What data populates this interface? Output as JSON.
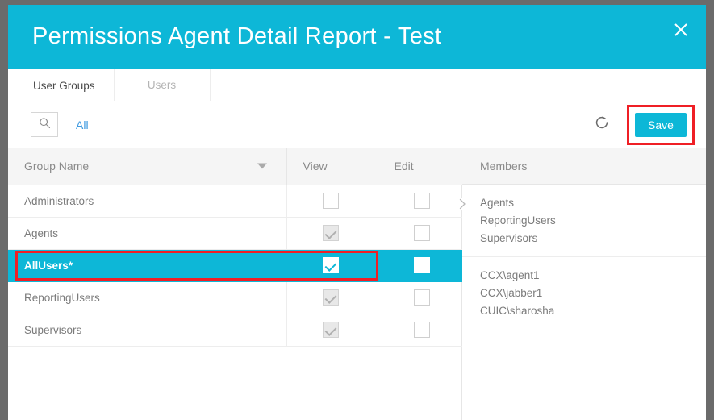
{
  "window": {
    "title": "Permissions Agent Detail Report - Test",
    "close_label": "×",
    "accent_color": "#0db7d7",
    "highlight_color": "#ef1f25"
  },
  "tabs": [
    {
      "label": "User Groups",
      "active": true
    },
    {
      "label": "Users",
      "active": false
    }
  ],
  "toolbar": {
    "search_icon": "search-icon",
    "all_label": "All",
    "refresh_icon": "refresh-icon",
    "save_label": "Save"
  },
  "table": {
    "columns": [
      "Group Name",
      "View",
      "Edit"
    ],
    "sort_indicator": "chevron-down-icon",
    "rows": [
      {
        "name": "Administrators",
        "view": "unchecked",
        "edit": "unchecked",
        "selected": false
      },
      {
        "name": "Agents",
        "view": "disabled-checked",
        "edit": "unchecked",
        "selected": false
      },
      {
        "name": "AllUsers*",
        "view": "checked",
        "edit": "unchecked",
        "selected": true
      },
      {
        "name": "ReportingUsers",
        "view": "disabled-checked",
        "edit": "unchecked",
        "selected": false
      },
      {
        "name": "Supervisors",
        "view": "disabled-checked",
        "edit": "unchecked",
        "selected": false
      }
    ]
  },
  "members": {
    "header": "Members",
    "groups": [
      [
        "Agents",
        "ReportingUsers",
        "Supervisors"
      ],
      [
        "CCX\\agent1",
        "CCX\\jabber1",
        "CUIC\\sharosha"
      ]
    ]
  }
}
